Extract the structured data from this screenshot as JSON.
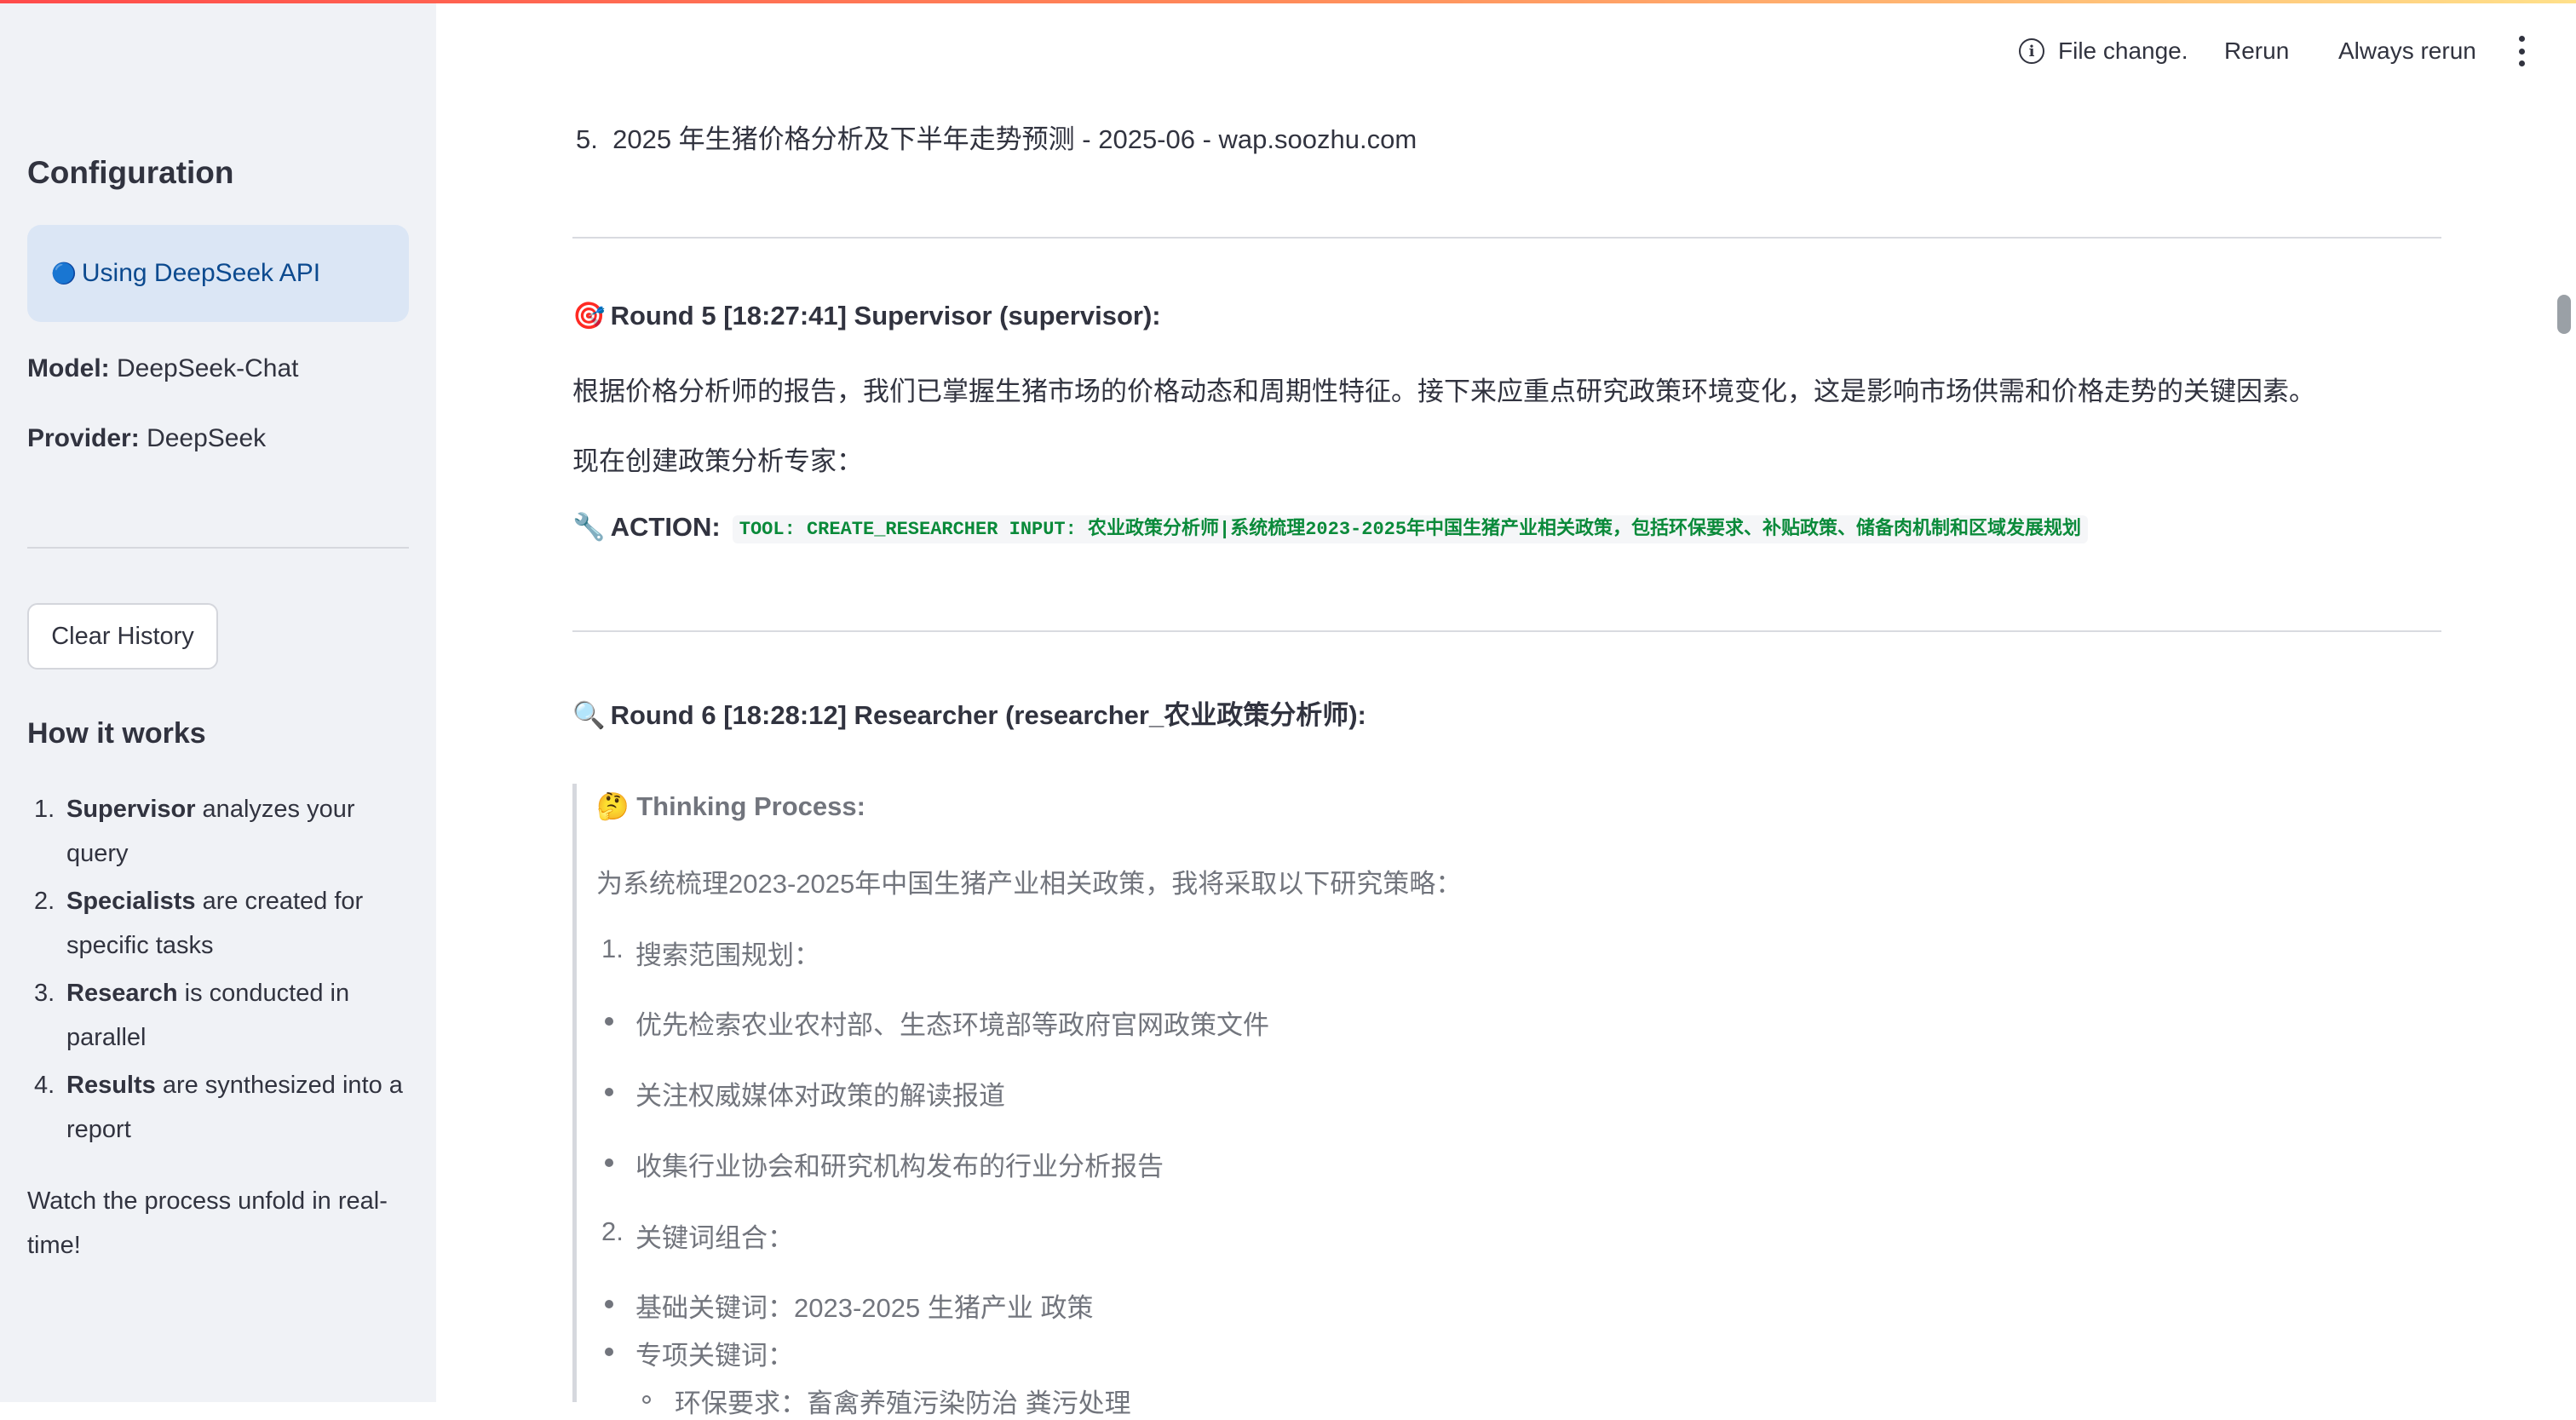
{
  "sidebar": {
    "title": "Configuration",
    "info": {
      "icon": "🔵",
      "text": "Using DeepSeek API"
    },
    "model_label": "Model:",
    "model_value": "DeepSeek-Chat",
    "provider_label": "Provider:",
    "provider_value": "DeepSeek",
    "clear_button": "Clear History",
    "how_title": "How it works",
    "steps": [
      {
        "num": "1.",
        "bold": "Supervisor",
        "rest": " analyzes your",
        "rest2": "query"
      },
      {
        "num": "2.",
        "bold": "Specialists",
        "rest": " are created for",
        "rest2": "specific tasks"
      },
      {
        "num": "3.",
        "bold": "Research",
        "rest": " is conducted in",
        "rest2": "parallel"
      },
      {
        "num": "4.",
        "bold": "Results",
        "rest": " are synthesized into a",
        "rest2": "report"
      }
    ],
    "footer_line1": "Watch the process unfold in real-",
    "footer_line2": "time!"
  },
  "header": {
    "status": "File change.",
    "rerun": "Rerun",
    "always_rerun": "Always rerun"
  },
  "main": {
    "top_item": {
      "num": "5.",
      "text": "2025 年生猪价格分析及下半年走势预测 - 2025-06 - wap.soozhu.com"
    },
    "round5": {
      "icon": "🎯",
      "heading": "Round 5 [18:27:41] Supervisor (supervisor):",
      "p1": "根据价格分析师的报告，我们已掌握生猪市场的价格动态和周期性特征。接下来应重点研究政策环境变化，这是影响市场供需和价格走势的关键因素。",
      "p2": "现在创建政策分析专家：",
      "action_icon": "🔧",
      "action_label": "ACTION:",
      "action_code": "TOOL: CREATE_RESEARCHER INPUT: 农业政策分析师|系统梳理2023-2025年中国生猪产业相关政策，包括环保要求、补贴政策、储备肉机制和区域发展规划"
    },
    "round6": {
      "icon": "🔍",
      "heading": "Round 6 [18:28:12] Researcher (researcher_农业政策分析师):",
      "thinking_icon": "🤔",
      "thinking_label": "Thinking Process:",
      "intro": "为系统梳理2023-2025年中国生猪产业相关政策，我将采取以下研究策略：",
      "s1_num": "1.",
      "s1": "搜索范围规划：",
      "b1": "优先检索农业农村部、生态环境部等政府官网政策文件",
      "b2": "关注权威媒体对政策的解读报道",
      "b3": "收集行业协会和研究机构发布的行业分析报告",
      "s2_num": "2.",
      "s2": "关键词组合：",
      "k1": "基础关键词：2023-2025 生猪产业 政策",
      "k2": "专项关键词：",
      "k3": "环保要求：畜禽养殖污染防治 粪污处理"
    }
  }
}
